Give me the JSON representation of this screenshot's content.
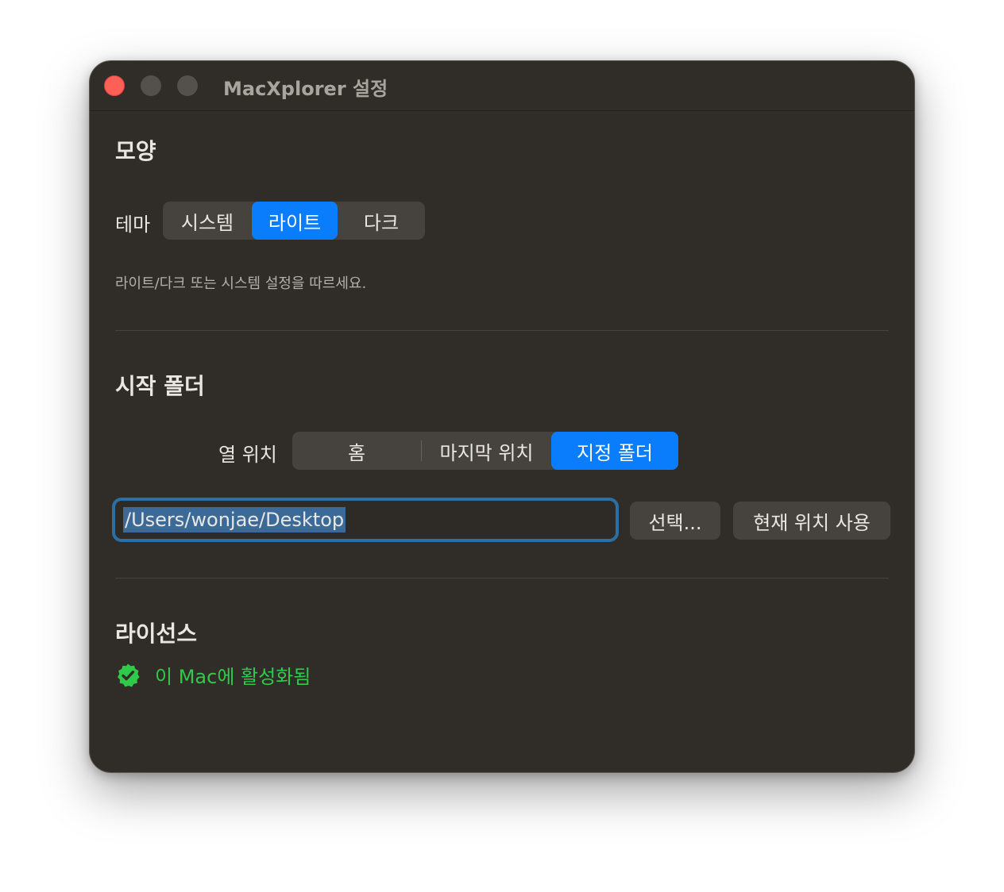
{
  "window": {
    "title": "MacXplorer 설정"
  },
  "appearance": {
    "section_title": "모양",
    "theme_label": "테마",
    "theme_options": [
      "시스템",
      "라이트",
      "다크"
    ],
    "theme_selected": "라이트",
    "hint": "라이트/다크 또는 시스템 설정을 따르세요."
  },
  "startup": {
    "section_title": "시작 폴더",
    "open_label": "열 위치",
    "open_options": [
      "홈",
      "마지막 위치",
      "지정 폴더"
    ],
    "open_selected": "지정 폴더",
    "path_value": "/Users/wonjae/Desktop",
    "choose_button": "선택...",
    "use_current_button": "현재 위치 사용"
  },
  "license": {
    "section_title": "라이선스",
    "status_text": "이 Mac에 활성화됨",
    "status_icon": "checkmark-seal-icon"
  },
  "colors": {
    "accent": "#0a7dfd",
    "success": "#2fca49",
    "close": "#fe5f57"
  }
}
